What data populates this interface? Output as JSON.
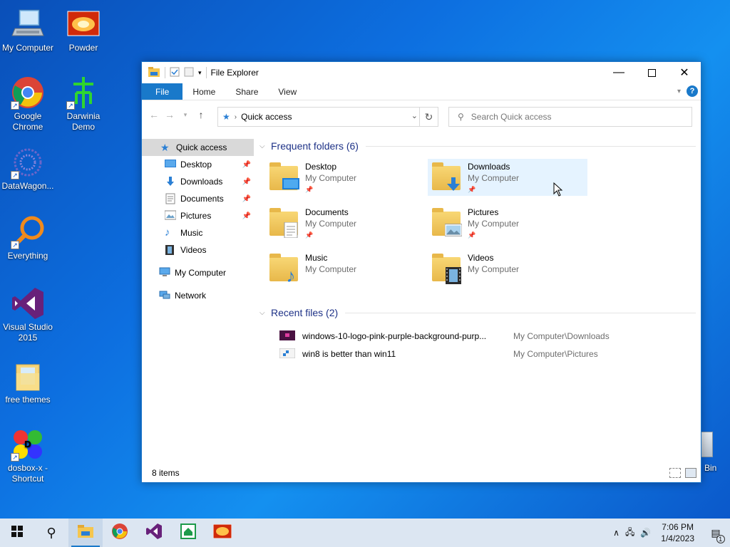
{
  "desktop": {
    "icons": [
      {
        "label": "My Computer",
        "icon": "computer-icon"
      },
      {
        "label": "Powder",
        "icon": "powder-icon"
      },
      {
        "label": "Google Chrome",
        "icon": "chrome-icon"
      },
      {
        "label": "Darwinia Demo",
        "icon": "darwinia-icon"
      },
      {
        "label": "DataWagon...",
        "icon": "datawagon-icon"
      },
      {
        "label": "Everything",
        "icon": "everything-icon"
      },
      {
        "label": "Visual Studio 2015",
        "icon": "visual-studio-icon"
      },
      {
        "label": "free themes",
        "icon": "folder-icon"
      },
      {
        "label": "dosbox-x - Shortcut",
        "icon": "dosbox-icon"
      }
    ],
    "recycle_label": "Bin"
  },
  "window": {
    "title": "File Explorer",
    "tabs": {
      "file": "File",
      "home": "Home",
      "share": "Share",
      "view": "View"
    },
    "help": "?",
    "address": {
      "location": "Quick access"
    },
    "search": {
      "placeholder": "Search Quick access"
    },
    "sidebar": {
      "quick_access": "Quick access",
      "items": [
        {
          "label": "Desktop",
          "pinned": true
        },
        {
          "label": "Downloads",
          "pinned": true
        },
        {
          "label": "Documents",
          "pinned": true
        },
        {
          "label": "Pictures",
          "pinned": true
        },
        {
          "label": "Music",
          "pinned": false
        },
        {
          "label": "Videos",
          "pinned": false
        }
      ],
      "my_computer": "My Computer",
      "network": "Network"
    },
    "frequent": {
      "header": "Frequent folders (6)",
      "folders": [
        {
          "name": "Desktop",
          "location": "My Computer",
          "pinned": true
        },
        {
          "name": "Downloads",
          "location": "My Computer",
          "pinned": true
        },
        {
          "name": "Documents",
          "location": "My Computer",
          "pinned": true
        },
        {
          "name": "Pictures",
          "location": "My Computer",
          "pinned": true
        },
        {
          "name": "Music",
          "location": "My Computer",
          "pinned": false
        },
        {
          "name": "Videos",
          "location": "My Computer",
          "pinned": false
        }
      ]
    },
    "recent": {
      "header": "Recent files (2)",
      "files": [
        {
          "name": "windows-10-logo-pink-purple-background-purp...",
          "path": "My Computer\\Downloads"
        },
        {
          "name": "win8 is better than win11",
          "path": "My Computer\\Pictures"
        }
      ]
    },
    "status": "8 items"
  },
  "taskbar": {
    "time": "7:06 PM",
    "date": "1/4/2023",
    "notification_count": "1"
  },
  "colors": {
    "accent": "#1979ca",
    "group_header": "#1e3287",
    "taskbar": "#dce6f2"
  }
}
